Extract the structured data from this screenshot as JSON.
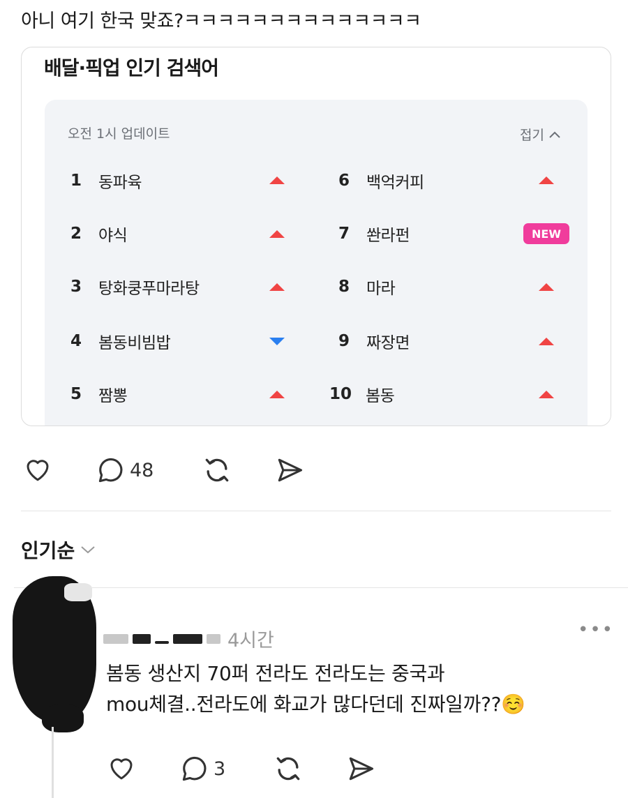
{
  "post": {
    "text": "아니 여기 한국 맞죠?ㅋㅋㅋㅋㅋㅋㅋㅋㅋㅋㅋㅋㅋㅋ"
  },
  "card": {
    "title": "배달·픽업 인기 검색어",
    "update_text": "오전 1시 업데이트",
    "fold_label": "접기",
    "rankings": [
      {
        "rank": "1",
        "term": "동파육",
        "trend": "up"
      },
      {
        "rank": "2",
        "term": "야식",
        "trend": "up"
      },
      {
        "rank": "3",
        "term": "탕화쿵푸마라탕",
        "trend": "up"
      },
      {
        "rank": "4",
        "term": "봄동비빔밥",
        "trend": "down"
      },
      {
        "rank": "5",
        "term": "짬뽕",
        "trend": "up"
      },
      {
        "rank": "6",
        "term": "백억커피",
        "trend": "up"
      },
      {
        "rank": "7",
        "term": "쏸라펀",
        "trend": "new"
      },
      {
        "rank": "8",
        "term": "마라",
        "trend": "up"
      },
      {
        "rank": "9",
        "term": "짜장면",
        "trend": "up"
      },
      {
        "rank": "10",
        "term": "봄동",
        "trend": "up"
      }
    ],
    "new_badge": "NEW",
    "colors": {
      "up": "#f04444",
      "down": "#2a7ff0",
      "new": "#f03c9c"
    }
  },
  "post_actions": {
    "comment_count": "48"
  },
  "sort": {
    "label": "인기순"
  },
  "reply": {
    "time": "4시간",
    "text_line1": "봄동 생산지 70퍼 전라도 전라도는 중국과",
    "text_line2": "mou체결..전라도에 화교가 많다던데 진짜일까??☺️",
    "comment_count": "3",
    "more_label": "•••"
  }
}
